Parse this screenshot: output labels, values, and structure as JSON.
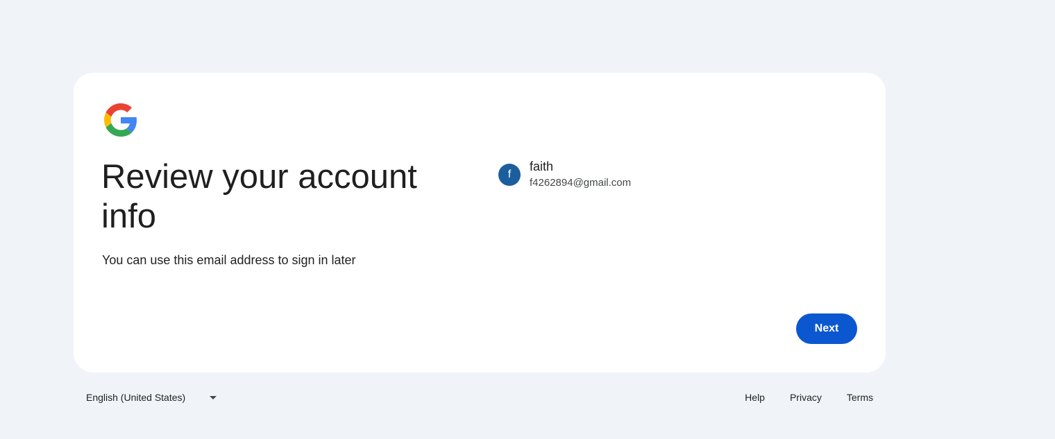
{
  "brand": {
    "logo_icon": "google-g-logo",
    "colors": {
      "blue": "#4285F4",
      "red": "#EA4335",
      "yellow": "#FBBC05",
      "green": "#34A853"
    }
  },
  "main": {
    "heading": "Review your account info",
    "subtext": "You can use this email address to sign in later"
  },
  "account": {
    "avatar_letter": "f",
    "avatar_color": "#1b5e9e",
    "name": "faith",
    "email": "f4262894@gmail.com"
  },
  "actions": {
    "next_label": "Next",
    "accent_color": "#0b57d0"
  },
  "footer": {
    "language": "English (United States)",
    "language_icon": "caret-down-icon",
    "links": [
      "Help",
      "Privacy",
      "Terms"
    ]
  }
}
